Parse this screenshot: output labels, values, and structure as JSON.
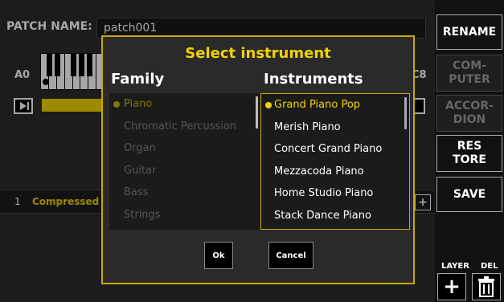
{
  "header": {
    "patch_label": "PATCH NAME:",
    "patch_value": "patch001"
  },
  "keyboard": {
    "low_note": "A0",
    "high_note": "C8"
  },
  "layer": {
    "number": "1",
    "name": "Compressed ."
  },
  "side": {
    "rename": "RENAME",
    "computer_1": "COM-",
    "computer_2": "PUTER",
    "accordion_1": "ACCOR-",
    "accordion_2": "DION",
    "restore_1": "RES",
    "restore_2": "TORE",
    "save": "SAVE",
    "layer_label": "LAYER",
    "del_label": "DEL"
  },
  "modal": {
    "title": "Select instrument",
    "family_heading": "Family",
    "instruments_heading": "Instruments",
    "families": [
      "Piano",
      "Chromatic Percussion",
      "Organ",
      "Guitar",
      "Bass",
      "Strings"
    ],
    "instruments": [
      "Grand Piano Pop",
      "Merish Piano",
      "Concert Grand Piano",
      "Mezzacoda Piano",
      "Home Studio Piano",
      "Stack Dance Piano"
    ],
    "ok_label": "Ok",
    "cancel_label": "Cancel"
  },
  "colors": {
    "accent": "#f0d400",
    "modal_border": "#c8aa00"
  }
}
